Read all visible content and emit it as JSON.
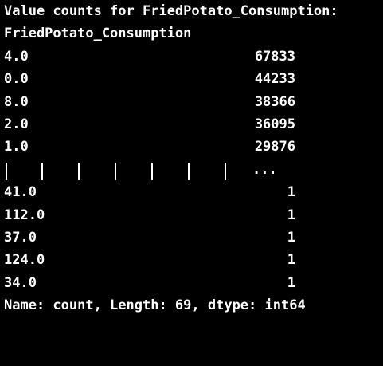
{
  "output": {
    "header": "Value counts for FriedPotato_Consumption:",
    "index_name": "FriedPotato_Consumption",
    "top_rows": [
      {
        "value": "4.0",
        "count": "67833"
      },
      {
        "value": "0.0",
        "count": "44233"
      },
      {
        "value": "8.0",
        "count": "38366"
      },
      {
        "value": "2.0",
        "count": "36095"
      },
      {
        "value": "1.0",
        "count": "29876"
      }
    ],
    "ellipsis": "...",
    "bottom_rows": [
      {
        "value": "41.0",
        "count": "1"
      },
      {
        "value": "112.0",
        "count": "1"
      },
      {
        "value": "37.0",
        "count": "1"
      },
      {
        "value": "124.0",
        "count": "1"
      },
      {
        "value": "34.0",
        "count": "1"
      }
    ],
    "footer": "Name: count, Length: 69, dtype: int64"
  }
}
